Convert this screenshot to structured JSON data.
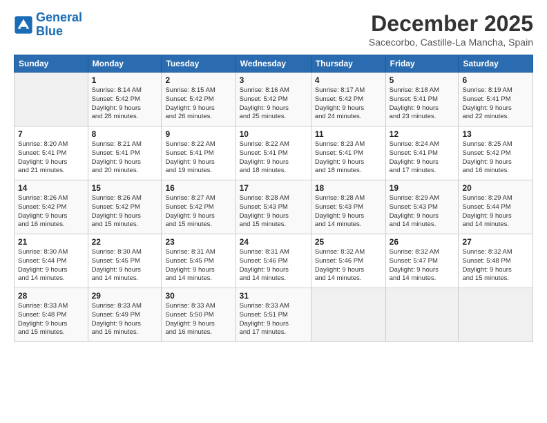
{
  "logo": {
    "line1": "General",
    "line2": "Blue"
  },
  "title": "December 2025",
  "location": "Sacecorbo, Castille-La Mancha, Spain",
  "header_days": [
    "Sunday",
    "Monday",
    "Tuesday",
    "Wednesday",
    "Thursday",
    "Friday",
    "Saturday"
  ],
  "weeks": [
    [
      {
        "day": "",
        "info": ""
      },
      {
        "day": "1",
        "info": "Sunrise: 8:14 AM\nSunset: 5:42 PM\nDaylight: 9 hours\nand 28 minutes."
      },
      {
        "day": "2",
        "info": "Sunrise: 8:15 AM\nSunset: 5:42 PM\nDaylight: 9 hours\nand 26 minutes."
      },
      {
        "day": "3",
        "info": "Sunrise: 8:16 AM\nSunset: 5:42 PM\nDaylight: 9 hours\nand 25 minutes."
      },
      {
        "day": "4",
        "info": "Sunrise: 8:17 AM\nSunset: 5:42 PM\nDaylight: 9 hours\nand 24 minutes."
      },
      {
        "day": "5",
        "info": "Sunrise: 8:18 AM\nSunset: 5:41 PM\nDaylight: 9 hours\nand 23 minutes."
      },
      {
        "day": "6",
        "info": "Sunrise: 8:19 AM\nSunset: 5:41 PM\nDaylight: 9 hours\nand 22 minutes."
      }
    ],
    [
      {
        "day": "7",
        "info": "Sunrise: 8:20 AM\nSunset: 5:41 PM\nDaylight: 9 hours\nand 21 minutes."
      },
      {
        "day": "8",
        "info": "Sunrise: 8:21 AM\nSunset: 5:41 PM\nDaylight: 9 hours\nand 20 minutes."
      },
      {
        "day": "9",
        "info": "Sunrise: 8:22 AM\nSunset: 5:41 PM\nDaylight: 9 hours\nand 19 minutes."
      },
      {
        "day": "10",
        "info": "Sunrise: 8:22 AM\nSunset: 5:41 PM\nDaylight: 9 hours\nand 18 minutes."
      },
      {
        "day": "11",
        "info": "Sunrise: 8:23 AM\nSunset: 5:41 PM\nDaylight: 9 hours\nand 18 minutes."
      },
      {
        "day": "12",
        "info": "Sunrise: 8:24 AM\nSunset: 5:41 PM\nDaylight: 9 hours\nand 17 minutes."
      },
      {
        "day": "13",
        "info": "Sunrise: 8:25 AM\nSunset: 5:42 PM\nDaylight: 9 hours\nand 16 minutes."
      }
    ],
    [
      {
        "day": "14",
        "info": "Sunrise: 8:26 AM\nSunset: 5:42 PM\nDaylight: 9 hours\nand 16 minutes."
      },
      {
        "day": "15",
        "info": "Sunrise: 8:26 AM\nSunset: 5:42 PM\nDaylight: 9 hours\nand 15 minutes."
      },
      {
        "day": "16",
        "info": "Sunrise: 8:27 AM\nSunset: 5:42 PM\nDaylight: 9 hours\nand 15 minutes."
      },
      {
        "day": "17",
        "info": "Sunrise: 8:28 AM\nSunset: 5:43 PM\nDaylight: 9 hours\nand 15 minutes."
      },
      {
        "day": "18",
        "info": "Sunrise: 8:28 AM\nSunset: 5:43 PM\nDaylight: 9 hours\nand 14 minutes."
      },
      {
        "day": "19",
        "info": "Sunrise: 8:29 AM\nSunset: 5:43 PM\nDaylight: 9 hours\nand 14 minutes."
      },
      {
        "day": "20",
        "info": "Sunrise: 8:29 AM\nSunset: 5:44 PM\nDaylight: 9 hours\nand 14 minutes."
      }
    ],
    [
      {
        "day": "21",
        "info": "Sunrise: 8:30 AM\nSunset: 5:44 PM\nDaylight: 9 hours\nand 14 minutes."
      },
      {
        "day": "22",
        "info": "Sunrise: 8:30 AM\nSunset: 5:45 PM\nDaylight: 9 hours\nand 14 minutes."
      },
      {
        "day": "23",
        "info": "Sunrise: 8:31 AM\nSunset: 5:45 PM\nDaylight: 9 hours\nand 14 minutes."
      },
      {
        "day": "24",
        "info": "Sunrise: 8:31 AM\nSunset: 5:46 PM\nDaylight: 9 hours\nand 14 minutes."
      },
      {
        "day": "25",
        "info": "Sunrise: 8:32 AM\nSunset: 5:46 PM\nDaylight: 9 hours\nand 14 minutes."
      },
      {
        "day": "26",
        "info": "Sunrise: 8:32 AM\nSunset: 5:47 PM\nDaylight: 9 hours\nand 14 minutes."
      },
      {
        "day": "27",
        "info": "Sunrise: 8:32 AM\nSunset: 5:48 PM\nDaylight: 9 hours\nand 15 minutes."
      }
    ],
    [
      {
        "day": "28",
        "info": "Sunrise: 8:33 AM\nSunset: 5:48 PM\nDaylight: 9 hours\nand 15 minutes."
      },
      {
        "day": "29",
        "info": "Sunrise: 8:33 AM\nSunset: 5:49 PM\nDaylight: 9 hours\nand 16 minutes."
      },
      {
        "day": "30",
        "info": "Sunrise: 8:33 AM\nSunset: 5:50 PM\nDaylight: 9 hours\nand 16 minutes."
      },
      {
        "day": "31",
        "info": "Sunrise: 8:33 AM\nSunset: 5:51 PM\nDaylight: 9 hours\nand 17 minutes."
      },
      {
        "day": "",
        "info": ""
      },
      {
        "day": "",
        "info": ""
      },
      {
        "day": "",
        "info": ""
      }
    ]
  ]
}
